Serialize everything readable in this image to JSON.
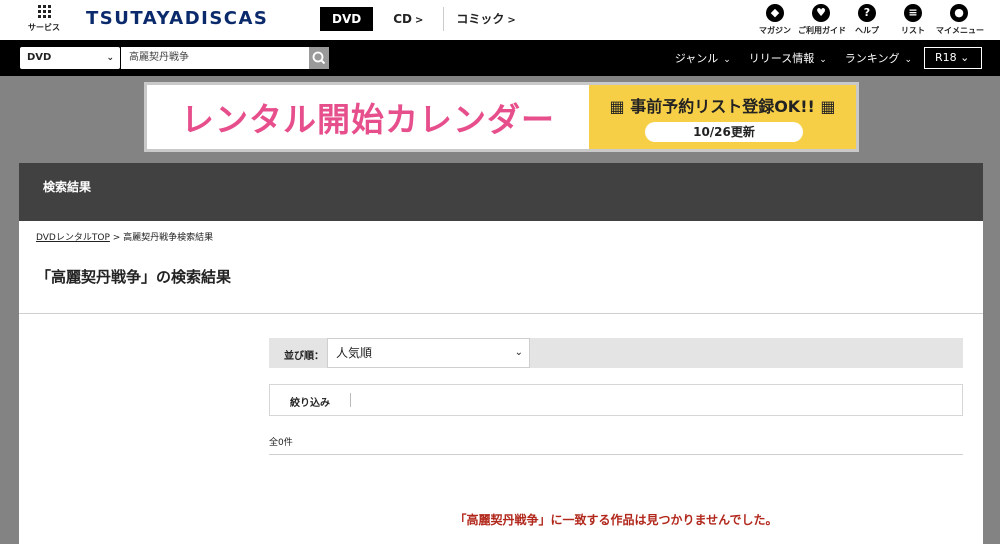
{
  "header": {
    "service_label": "サービス",
    "logo": "TSUTAYADISCAS",
    "tabs": [
      {
        "label": "DVD",
        "active": true
      },
      {
        "label": "CD",
        "active": false
      },
      {
        "label": "コミック",
        "active": false
      }
    ],
    "icons": [
      {
        "label": "マガジン",
        "icon": "magazine-icon"
      },
      {
        "label": "ご利用ガイド",
        "icon": "guide-icon"
      },
      {
        "label": "ヘルプ",
        "icon": "help-icon"
      },
      {
        "label": "リスト",
        "icon": "list-icon"
      },
      {
        "label": "マイメニュー",
        "icon": "user-icon"
      }
    ]
  },
  "search": {
    "category": "DVD",
    "query": "高麗契丹戦争",
    "menus": [
      "ジャンル",
      "リリース情報",
      "ランキング"
    ],
    "r18": "R18"
  },
  "banner": {
    "title": "レンタル開始カレンダー",
    "subtitle": "事前予約リスト登録OK!!",
    "date": "10/26更新"
  },
  "content": {
    "section_header": "検索結果",
    "breadcrumb_link": "DVDレンタルTOP",
    "breadcrumb_sep": " > ",
    "breadcrumb_current": "高麗契丹戦争検索結果",
    "page_title": "「高麗契丹戦争」の検索結果",
    "sort_label": "並び順：",
    "sort_value": "人気順",
    "filter_label": "絞り込み",
    "count": "全0件",
    "no_results": "「高麗契丹戦争」に一致する作品は見つかりませんでした。"
  },
  "colors": {
    "header_dark": "#414141",
    "accent_red": "#b2281c",
    "banner_yellow": "#f7cf47",
    "banner_pink": "#e74f8c"
  }
}
